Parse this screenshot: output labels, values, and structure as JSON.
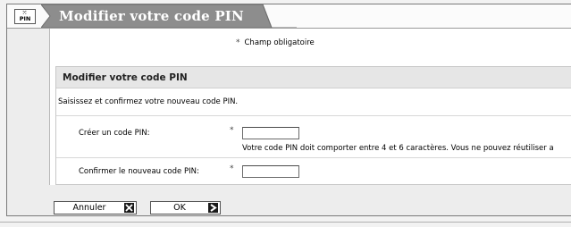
{
  "header": {
    "app_icon_text": "PIN",
    "title": "Modifier votre code PIN"
  },
  "form": {
    "required_star": "*",
    "required_note": "Champ obligatoire",
    "section_title": "Modifier votre code PIN",
    "intro": "Saisissez et confirmez votre nouveau code PIN.",
    "create_label": "Créer un code PIN:",
    "create_value": "",
    "create_hint": "Votre code PIN doit comporter entre 4 et 6 caractères. Vous ne pouvez réutiliser a",
    "confirm_label": "Confirmer le nouveau code PIN:",
    "confirm_value": ""
  },
  "buttons": {
    "cancel_label": "Annuler",
    "ok_label": "OK"
  },
  "icons": {
    "app": "pin-keypad-icon",
    "cancel": "close-x-icon",
    "ok": "arrow-right-icon"
  }
}
